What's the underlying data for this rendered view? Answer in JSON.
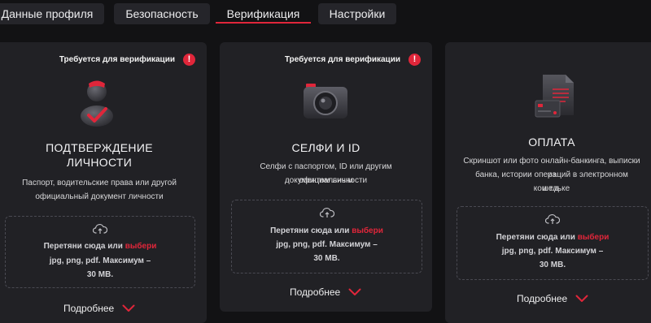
{
  "tabs": [
    {
      "label": "Данные профиля"
    },
    {
      "label": "Безопасность"
    },
    {
      "label": "Верификация"
    },
    {
      "label": "Настройки"
    }
  ],
  "cards": [
    {
      "required": "Требуется для верификации",
      "title_line1": "ПОДТВЕРЖДЕНИЕ",
      "title_line2": "ЛИЧНОСТИ",
      "desc_line1": "Паспорт, водительские права или другой",
      "desc_line2": "официальный документ личности",
      "drop_prefix": "Перетяни сюда или ",
      "drop_link": "выбери",
      "drop_line2": "jpg, png, pdf. Максимум –",
      "drop_line3": "30 MB.",
      "more": "Подробнее",
      "icon": "person-check-icon"
    },
    {
      "required": "Требуется для верификации",
      "title_line1": "СЕЛФИ И ID",
      "desc_line1": "Селфи с паспортом, ID или другим официальным",
      "desc_line2": "документом личности",
      "drop_prefix": "Перетяни сюда или ",
      "drop_link": "выбери",
      "drop_line2": "jpg, png, pdf. Максимум –",
      "drop_line3": "30 MB.",
      "more": "Подробнее",
      "icon": "camera-icon"
    },
    {
      "title_line1": "ОПЛАТА",
      "desc_line1": "Скриншот или фото онлайн-банкинга, выписки из",
      "desc_line2": "банка, истории операций в электронном кошельке",
      "desc_line3": "и т.д.",
      "drop_prefix": "Перетяни сюда или ",
      "drop_link": "выбери",
      "drop_line2": "jpg, png, pdf. Максимум –",
      "drop_line3": "30 MB.",
      "more": "Подробнее",
      "icon": "document-card-icon"
    }
  ],
  "colors": {
    "accent": "#e0263a",
    "card": "#212125",
    "background": "#121214"
  }
}
